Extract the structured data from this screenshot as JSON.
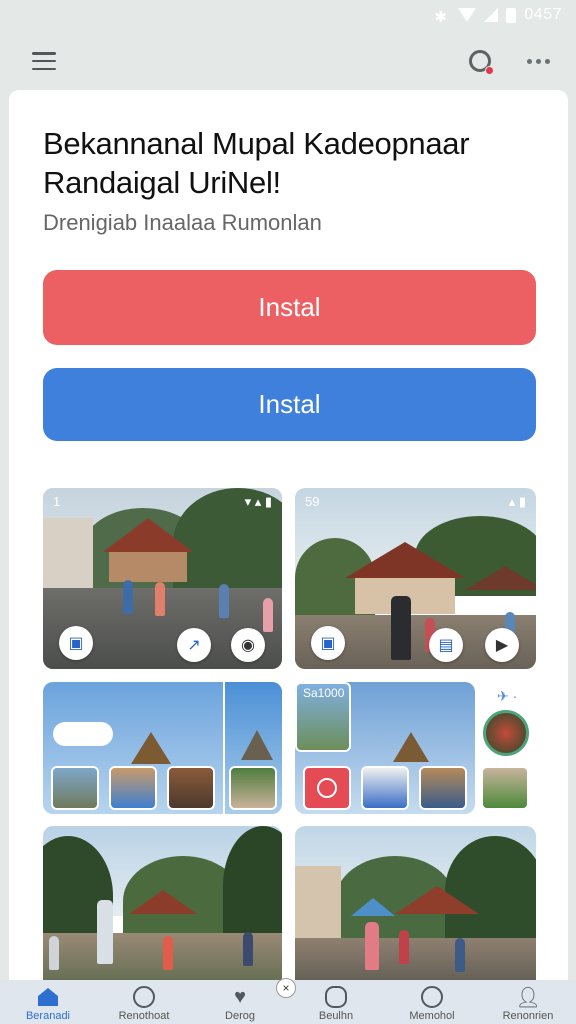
{
  "status_bar": {
    "time": "0457"
  },
  "header": {
    "menu_icon": "hamburger-icon",
    "search_icon": "search-icon",
    "more_icon": "more-dots-icon"
  },
  "main": {
    "title": "Bekannanal Mupal Kadeopnaar Randaigal UriNel!",
    "subtitle": "Drenigiab Inaalaa Rumonlan",
    "buttons": [
      {
        "label": "Instal",
        "color": "#ec5f62"
      },
      {
        "label": "Instal",
        "color": "#3f80dd"
      }
    ]
  },
  "gallery": {
    "tile1_status": "1",
    "tile2_status": "59",
    "tile3_label": "",
    "tile4_label": "Sa1000"
  },
  "bottom_nav": {
    "items": [
      {
        "label": "Beranadi",
        "icon": "home-icon"
      },
      {
        "label": "Renothoat",
        "icon": "chat-icon"
      },
      {
        "label": "Derog",
        "icon": "heart-icon"
      },
      {
        "label": "Beulhn",
        "icon": "message-icon"
      },
      {
        "label": "Memohol",
        "icon": "bubble-icon"
      },
      {
        "label": "Renonrien",
        "icon": "profile-icon"
      }
    ]
  },
  "colors": {
    "accent": "#2c6fd1",
    "red": "#ec5f62",
    "blue": "#3f80dd"
  }
}
